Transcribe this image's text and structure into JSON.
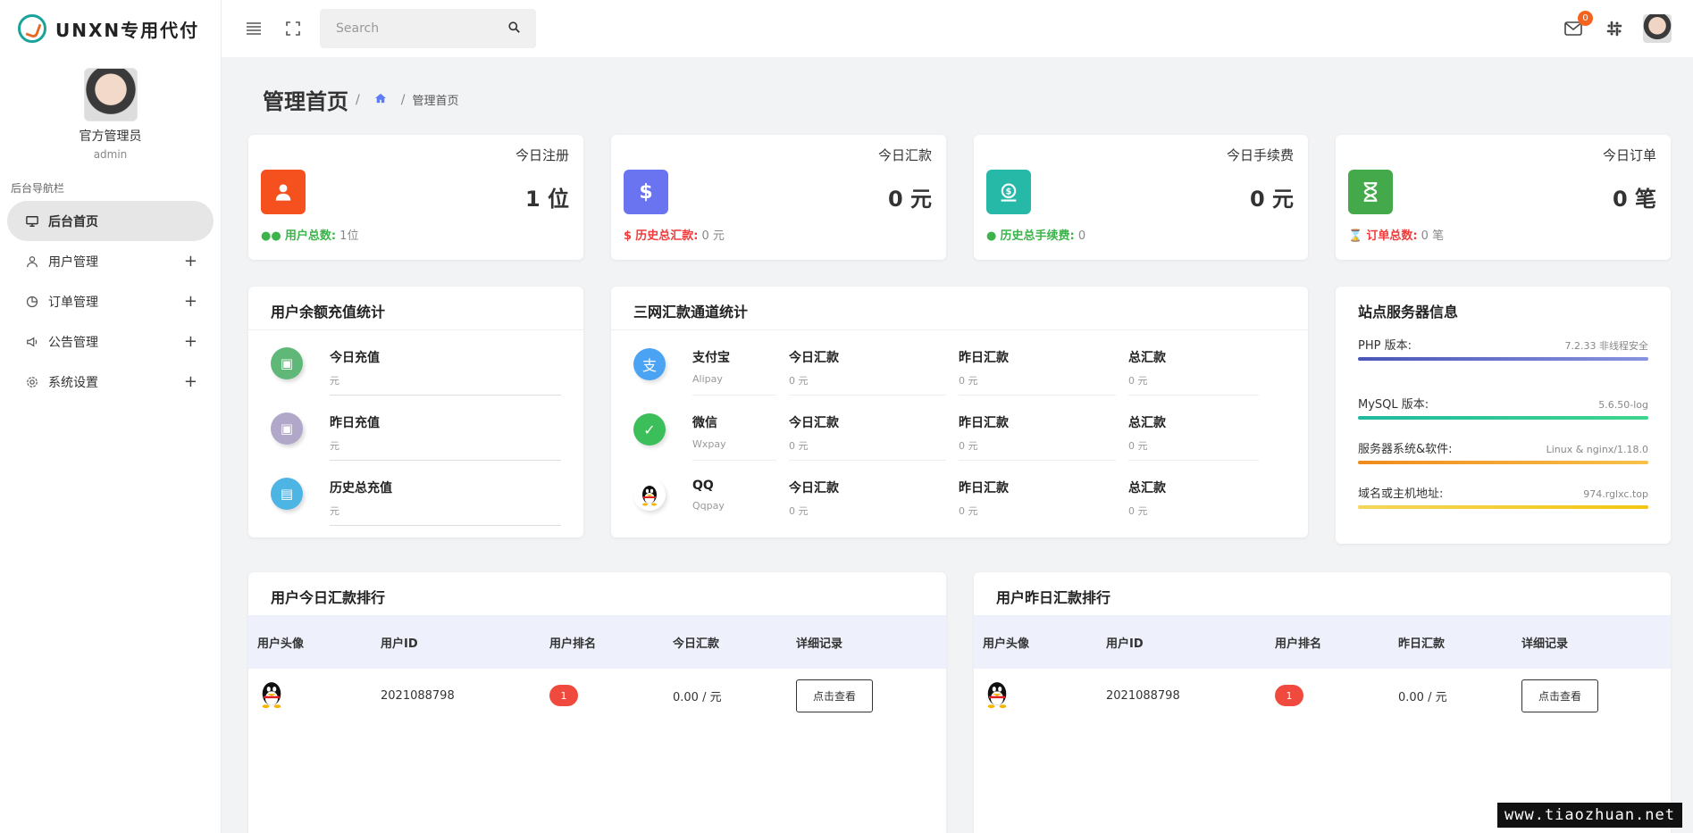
{
  "brand": {
    "name": "UNXN专用代付"
  },
  "profile": {
    "name": "官方管理员",
    "role": "admin"
  },
  "nav": {
    "header": "后台导航栏",
    "items": [
      {
        "label": "后台首页",
        "icon": "monitor-icon",
        "active": true
      },
      {
        "label": "用户管理",
        "icon": "user-icon",
        "expand": "+"
      },
      {
        "label": "订单管理",
        "icon": "pie-chart-icon",
        "expand": "+"
      },
      {
        "label": "公告管理",
        "icon": "megaphone-icon",
        "expand": "+"
      },
      {
        "label": "系统设置",
        "icon": "gear-icon",
        "expand": "+"
      }
    ]
  },
  "topbar": {
    "search_placeholder": "Search",
    "mail_count": "0"
  },
  "page": {
    "title": "管理首页",
    "breadcrumb_sep": "/",
    "breadcrumb_current": "管理首页"
  },
  "stats": [
    {
      "label": "今日注册",
      "value": "1 位",
      "foot_key": "用户总数:",
      "foot_val": "1位",
      "color": "#f4511e",
      "foot_color": "#3cb44b",
      "icon": "user-icon"
    },
    {
      "label": "今日汇款",
      "value": "0 元",
      "foot_key": "历史总汇款:",
      "foot_val": "0 元",
      "color": "#6b74f0",
      "foot_color": "#f03c3c",
      "icon": "dollar-icon"
    },
    {
      "label": "今日手续费",
      "value": "0 元",
      "foot_key": "历史总手续费:",
      "foot_val": "0",
      "color": "#26b9a8",
      "foot_color": "#3cb44b",
      "icon": "money-bag-icon"
    },
    {
      "label": "今日订单",
      "value": "0 笔",
      "foot_key": "订单总数:",
      "foot_val": "0 笔",
      "color": "#43a94a",
      "foot_color": "#f03c3c",
      "icon": "hourglass-icon"
    }
  ],
  "recharge": {
    "title": "用户余额充值统计",
    "items": [
      {
        "name": "今日充值",
        "unit": "元",
        "color": "#5fb878",
        "icon": "calendar-icon"
      },
      {
        "name": "昨日充值",
        "unit": "元",
        "color": "#b1a7c9",
        "icon": "calendar-icon"
      },
      {
        "name": "历史总充值",
        "unit": "元",
        "color": "#4db5e4",
        "icon": "wallet-icon"
      }
    ]
  },
  "channels": {
    "title": "三网汇款通道统计",
    "rows": [
      {
        "name": "支付宝",
        "sub": "Alipay",
        "icon": "alipay-icon",
        "color": "#4ba3f3",
        "today_label": "今日汇款",
        "today": "0 元",
        "yesterday_label": "昨日汇款",
        "yesterday": "0 元",
        "total_label": "总汇款",
        "total": "0 元"
      },
      {
        "name": "微信",
        "sub": "Wxpay",
        "icon": "wechat-icon",
        "color": "#3cbf5a",
        "today_label": "今日汇款",
        "today": "0 元",
        "yesterday_label": "昨日汇款",
        "yesterday": "0 元",
        "total_label": "总汇款",
        "total": "0 元"
      },
      {
        "name": "QQ",
        "sub": "Qqpay",
        "icon": "qq-icon",
        "color": "#ffffff",
        "today_label": "今日汇款",
        "today": "0 元",
        "yesterday_label": "昨日汇款",
        "yesterday": "0 元",
        "total_label": "总汇款",
        "total": "0 元"
      }
    ]
  },
  "server": {
    "title": "站点服务器信息",
    "rows": [
      {
        "key": "PHP 版本:",
        "value": "7.2.33 非线程安全",
        "color": "#5b64c4"
      },
      {
        "key": "MySQL 版本:",
        "value": "5.6.50-log",
        "color": "#2dc7a8"
      },
      {
        "key": "服务器系统&软件:",
        "value": "Linux & nginx/1.18.0",
        "color": "#f5a623"
      },
      {
        "key": "域名或主机地址:",
        "value": "974.rglxc.top",
        "color": "#f7d23e"
      }
    ]
  },
  "rank_today": {
    "title": "用户今日汇款排行",
    "headers": [
      "用户头像",
      "用户ID",
      "用户排名",
      "今日汇款",
      "详细记录"
    ],
    "rows": [
      {
        "id": "2021088798",
        "rank": "1",
        "amount": "0.00 / 元",
        "action": "点击查看"
      }
    ]
  },
  "rank_yesterday": {
    "title": "用户昨日汇款排行",
    "headers": [
      "用户头像",
      "用户ID",
      "用户排名",
      "昨日汇款",
      "详细记录"
    ],
    "rows": [
      {
        "id": "2021088798",
        "rank": "1",
        "amount": "0.00 / 元",
        "action": "点击查看"
      }
    ]
  },
  "watermark": "www.tiaozhuan.net"
}
